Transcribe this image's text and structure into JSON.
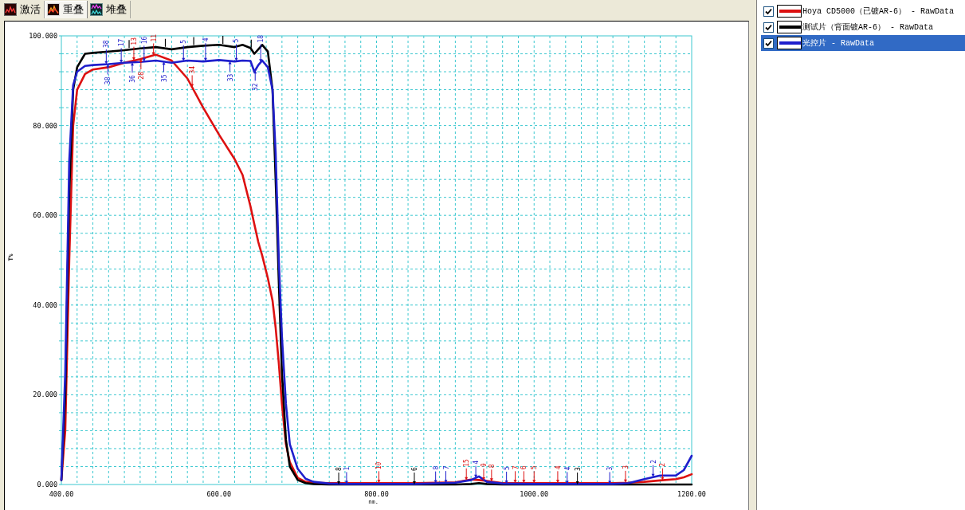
{
  "tabs": [
    {
      "label": "激活",
      "kind": "single",
      "selected": false
    },
    {
      "label": "重叠",
      "kind": "overlay",
      "selected": true
    },
    {
      "label": "堆叠",
      "kind": "stacked",
      "selected": false
    }
  ],
  "chart": {
    "chart_data": {
      "type": "line",
      "xlabel": "nm.",
      "ylabel": "T%",
      "x": [
        400,
        405,
        410,
        415,
        420,
        430,
        440,
        460,
        480,
        500,
        520,
        540,
        560,
        580,
        600,
        620,
        630,
        640,
        645,
        650,
        655,
        662,
        668,
        672,
        676,
        680,
        685,
        690,
        700,
        710,
        720,
        740,
        760,
        800,
        850,
        900,
        920,
        930,
        940,
        960,
        1000,
        1050,
        1100,
        1120,
        1140,
        1160,
        1180,
        1190,
        1200
      ],
      "series": [
        {
          "color": "#dd1111",
          "values": [
            1,
            12,
            50,
            80,
            88,
            91.5,
            92.5,
            93,
            94,
            94.8,
            95.8,
            94.5,
            90.5,
            84,
            78,
            72.5,
            69,
            62,
            58,
            54,
            51,
            46,
            41,
            35,
            27,
            18,
            9,
            5,
            1.5,
            0.6,
            0.4,
            0.3,
            0.3,
            0.3,
            0.3,
            0.5,
            1.1,
            1.0,
            0.8,
            0.3,
            0.3,
            0.3,
            0.3,
            0.4,
            0.6,
            0.9,
            1.2,
            1.6,
            2.3
          ]
        },
        {
          "color": "#000000",
          "values": [
            1,
            20,
            65,
            88,
            93,
            96,
            96.2,
            96.5,
            96.8,
            97.2,
            97.5,
            97,
            97.5,
            97.8,
            98,
            97.5,
            98,
            97.3,
            96,
            97,
            98,
            96.5,
            88,
            68,
            45,
            25,
            10,
            4,
            1,
            0.3,
            0.1,
            0,
            0,
            0,
            0,
            0,
            0.1,
            0.3,
            0.1,
            0,
            0,
            0,
            0,
            0,
            0,
            0,
            0,
            0,
            0
          ]
        },
        {
          "color": "#1f1fcc",
          "values": [
            1,
            25,
            72,
            89,
            92,
            93.3,
            93.5,
            93.7,
            94,
            94.2,
            94.5,
            94,
            94.5,
            94.3,
            94.6,
            94.3,
            94.5,
            94.4,
            92,
            93.5,
            94.5,
            93,
            88,
            74,
            50,
            33,
            18,
            9,
            3.5,
            1.3,
            0.6,
            0.2,
            0.1,
            0.1,
            0.1,
            0.4,
            1.0,
            1.8,
            0.6,
            0.2,
            0.1,
            0.1,
            0.1,
            0.3,
            1.2,
            2.0,
            2.0,
            3.2,
            6.4
          ]
        }
      ],
      "xlim": [
        400,
        1200
      ],
      "ylim": [
        0,
        100
      ],
      "grid": true,
      "xticks": [
        {
          "value": 400,
          "label": "400.00"
        },
        {
          "value": 600,
          "label": "600.00"
        },
        {
          "value": 800,
          "label": "800.00"
        },
        {
          "value": 1000,
          "label": "1000.00"
        },
        {
          "value": 1200,
          "label": "1200.00"
        }
      ],
      "yticks": [
        {
          "value": 0,
          "label": "0.000"
        },
        {
          "value": 20,
          "label": "20.000"
        },
        {
          "value": 40,
          "label": "40.000"
        },
        {
          "value": 60,
          "label": "60.000"
        },
        {
          "value": 80,
          "label": "80.000"
        },
        {
          "value": 100,
          "label": "100.000"
        }
      ],
      "annotations": [
        {
          "text": "38",
          "x": 457,
          "y": 93.67
        },
        {
          "text": "17",
          "x": 476,
          "y": 93.94
        },
        {
          "text": "13",
          "x": 492,
          "y": 94.48
        },
        {
          "text": "16",
          "x": 505,
          "y": 94.28
        },
        {
          "text": "11",
          "x": 517,
          "y": 95.65
        },
        {
          "text": "5",
          "x": 555,
          "y": 94.38
        },
        {
          "text": "4",
          "x": 583,
          "y": 94.35
        },
        {
          "text": "5",
          "x": 622,
          "y": 94.34
        },
        {
          "text": "18",
          "x": 653,
          "y": 94.1
        },
        {
          "text": "38",
          "x": 459,
          "y": 93.69
        },
        {
          "text": "36",
          "x": 490,
          "y": 94.1
        },
        {
          "text": "28",
          "x": 501,
          "y": 94.85
        },
        {
          "text": "35",
          "x": 530,
          "y": 94.25
        },
        {
          "text": "34",
          "x": 566,
          "y": 88.55
        },
        {
          "text": "33",
          "x": 614,
          "y": 94.39
        },
        {
          "text": "32",
          "x": 646,
          "y": 92.3
        },
        {
          "text": "8",
          "x": 752,
          "y": 0
        },
        {
          "text": "1",
          "x": 762,
          "y": 0.1
        },
        {
          "text": "10",
          "x": 803,
          "y": 0.3
        },
        {
          "text": "6",
          "x": 848,
          "y": 0
        },
        {
          "text": "8",
          "x": 875,
          "y": 0.25
        },
        {
          "text": "7",
          "x": 888,
          "y": 0.33
        },
        {
          "text": "15",
          "x": 914,
          "y": 0.92
        },
        {
          "text": "4",
          "x": 926,
          "y": 1.48
        },
        {
          "text": "9",
          "x": 936,
          "y": 0.88
        },
        {
          "text": "8",
          "x": 946,
          "y": 0.65
        },
        {
          "text": "5",
          "x": 965,
          "y": 0.19
        },
        {
          "text": "7",
          "x": 976,
          "y": 0.3
        },
        {
          "text": "6",
          "x": 987,
          "y": 0.3
        },
        {
          "text": "5",
          "x": 1000,
          "y": 0.3
        },
        {
          "text": "4",
          "x": 1030,
          "y": 0.3
        },
        {
          "text": "4",
          "x": 1042,
          "y": 0.1
        },
        {
          "text": "3",
          "x": 1055,
          "y": 0
        },
        {
          "text": "3",
          "x": 1096,
          "y": 0.1
        },
        {
          "text": "3",
          "x": 1116,
          "y": 0.38
        },
        {
          "text": "2",
          "x": 1151,
          "y": 1.64
        },
        {
          "text": "2",
          "x": 1163,
          "y": 0.95
        }
      ]
    }
  },
  "legend": {
    "items": [
      {
        "label": "Hoya CD5000（已镀AR-6） - RawData",
        "color": "#dd1111",
        "checked": true,
        "selected": false
      },
      {
        "label": "测试片（背面镀AR-6） - RawData",
        "color": "#000000",
        "checked": true,
        "selected": false
      },
      {
        "label": "光控片 - RawData",
        "color": "#1f1fcc",
        "checked": true,
        "selected": true
      }
    ]
  }
}
